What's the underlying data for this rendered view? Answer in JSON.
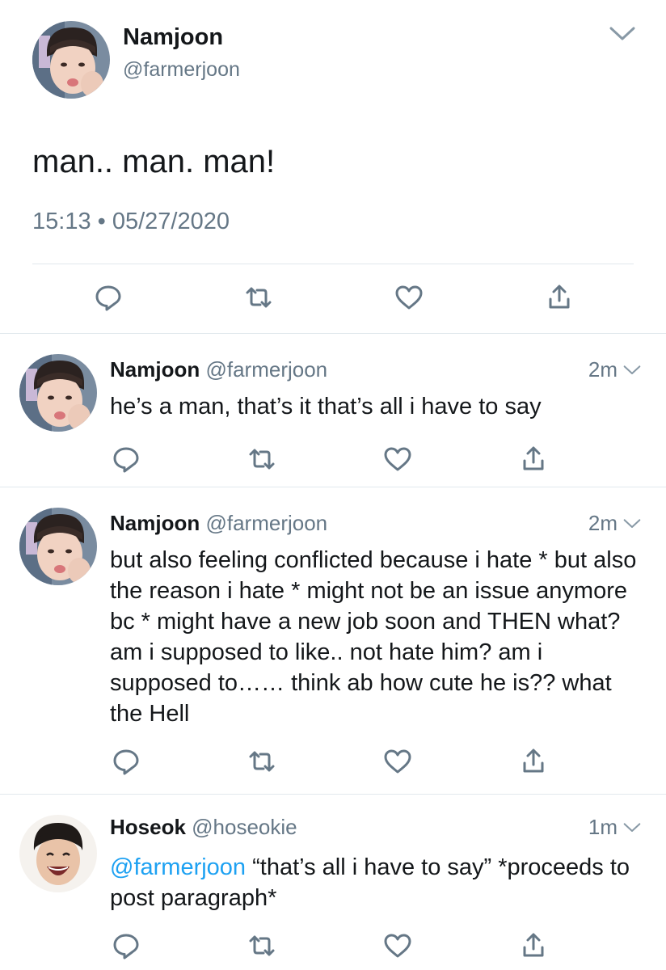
{
  "main_tweet": {
    "name": "Namjoon",
    "handle": "@farmerjoon",
    "text": "man.. man. man!",
    "timestamp": "15:13 • 05/27/2020"
  },
  "replies": [
    {
      "name": "Namjoon",
      "handle": "@farmerjoon",
      "time": "2m",
      "mention": "",
      "text": "he’s a man, that’s it that’s all i have to say"
    },
    {
      "name": "Namjoon",
      "handle": "@farmerjoon",
      "time": "2m",
      "mention": "",
      "text": "but also feeling conflicted because i hate * but also the reason i hate * might not be an issue anymore bc * might have a new job soon and THEN what? am i supposed to like.. not hate him? am i supposed to…… think ab how cute he is?? what the Hell"
    },
    {
      "name": "Hoseok",
      "handle": "@hoseokie",
      "time": "1m",
      "mention": "@farmerjoon",
      "text": " “that’s all i have to say” *proceeds to post paragraph*"
    }
  ],
  "icons": {
    "reply": "reply-icon",
    "retweet": "retweet-icon",
    "like": "like-icon",
    "share": "share-icon",
    "more": "chevron-down-icon"
  },
  "colors": {
    "icon_gray": "#657786",
    "mention_blue": "#1da1f2",
    "divider": "#e1e8ed"
  }
}
